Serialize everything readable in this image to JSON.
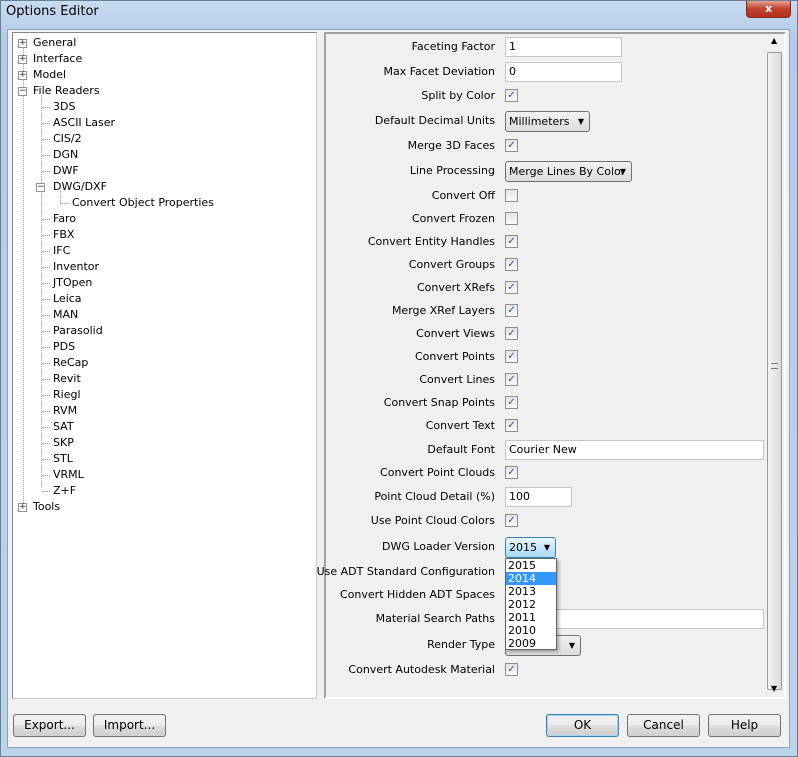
{
  "window": {
    "title": "Options Editor",
    "close": "x"
  },
  "tree": [
    {
      "label": "General",
      "level": 0,
      "exp": "+"
    },
    {
      "label": "Interface",
      "level": 0,
      "exp": "+"
    },
    {
      "label": "Model",
      "level": 0,
      "exp": "+"
    },
    {
      "label": "File Readers",
      "level": 0,
      "exp": "-"
    },
    {
      "label": "3DS",
      "level": 1
    },
    {
      "label": "ASCII Laser",
      "level": 1
    },
    {
      "label": "CIS/2",
      "level": 1
    },
    {
      "label": "DGN",
      "level": 1
    },
    {
      "label": "DWF",
      "level": 1
    },
    {
      "label": "DWG/DXF",
      "level": 1,
      "exp": "-"
    },
    {
      "label": "Convert Object Properties",
      "level": 2
    },
    {
      "label": "Faro",
      "level": 1
    },
    {
      "label": "FBX",
      "level": 1
    },
    {
      "label": "IFC",
      "level": 1
    },
    {
      "label": "Inventor",
      "level": 1
    },
    {
      "label": "JTOpen",
      "level": 1
    },
    {
      "label": "Leica",
      "level": 1
    },
    {
      "label": "MAN",
      "level": 1
    },
    {
      "label": "Parasolid",
      "level": 1
    },
    {
      "label": "PDS",
      "level": 1
    },
    {
      "label": "ReCap",
      "level": 1
    },
    {
      "label": "Revit",
      "level": 1
    },
    {
      "label": "Riegl",
      "level": 1
    },
    {
      "label": "RVM",
      "level": 1
    },
    {
      "label": "SAT",
      "level": 1
    },
    {
      "label": "SKP",
      "level": 1
    },
    {
      "label": "STL",
      "level": 1
    },
    {
      "label": "VRML",
      "level": 1
    },
    {
      "label": "Z+F",
      "level": 1
    },
    {
      "label": "Tools",
      "level": 0,
      "exp": "+"
    }
  ],
  "options": [
    {
      "label": "Faceting Factor",
      "type": "text",
      "value": "1"
    },
    {
      "label": "Max Facet Deviation",
      "type": "text",
      "value": "0"
    },
    {
      "label": "Split by Color",
      "type": "check",
      "checked": true
    },
    {
      "label": "Default Decimal Units",
      "type": "select",
      "value": "Millimeters"
    },
    {
      "label": "Merge 3D Faces",
      "type": "check",
      "checked": true
    },
    {
      "label": "Line Processing",
      "type": "select",
      "value": "Merge Lines By Color"
    },
    {
      "label": "Convert Off",
      "type": "check",
      "checked": false
    },
    {
      "label": "Convert Frozen",
      "type": "check",
      "checked": false
    },
    {
      "label": "Convert Entity Handles",
      "type": "check",
      "checked": true
    },
    {
      "label": "Convert Groups",
      "type": "check",
      "checked": true
    },
    {
      "label": "Convert XRefs",
      "type": "check",
      "checked": true
    },
    {
      "label": "Merge XRef Layers",
      "type": "check",
      "checked": true
    },
    {
      "label": "Convert Views",
      "type": "check",
      "checked": true
    },
    {
      "label": "Convert Points",
      "type": "check",
      "checked": true
    },
    {
      "label": "Convert Lines",
      "type": "check",
      "checked": true
    },
    {
      "label": "Convert Snap Points",
      "type": "check",
      "checked": true
    },
    {
      "label": "Convert Text",
      "type": "check",
      "checked": true
    },
    {
      "label": "Default Font",
      "type": "text",
      "value": "Courier New"
    },
    {
      "label": "Convert Point Clouds",
      "type": "check",
      "checked": true
    },
    {
      "label": "Point Cloud Detail (%)",
      "type": "text",
      "value": "100"
    },
    {
      "label": "Use Point Cloud Colors",
      "type": "check",
      "checked": true
    },
    {
      "label": "DWG Loader Version",
      "type": "select",
      "value": "2015"
    },
    {
      "label": "Use ADT Standard Configuration",
      "type": "none"
    },
    {
      "label": "Convert Hidden ADT Spaces",
      "type": "none"
    },
    {
      "label": "Material Search Paths",
      "type": "text",
      "value": ""
    },
    {
      "label": "Render Type",
      "type": "select",
      "value": ""
    },
    {
      "label": "Convert Autodesk Material",
      "type": "check",
      "checked": true
    }
  ],
  "dropdown": {
    "items": [
      "2015",
      "2014",
      "2013",
      "2012",
      "2011",
      "2010",
      "2009"
    ],
    "highlighted": "2014"
  },
  "buttons": {
    "export": "Export...",
    "import": "Import...",
    "ok": "OK",
    "cancel": "Cancel",
    "help": "Help"
  }
}
